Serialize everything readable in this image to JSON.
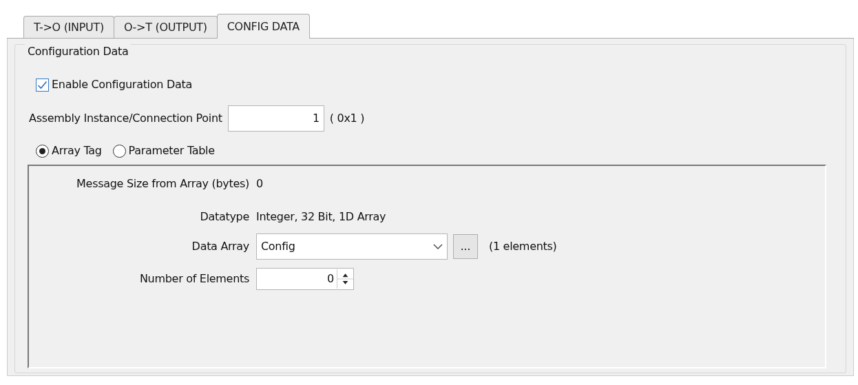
{
  "tabs": [
    {
      "label": "T->O (INPUT)",
      "selected": false
    },
    {
      "label": "O->T (OUTPUT)",
      "selected": false
    },
    {
      "label": "CONFIG DATA",
      "selected": true
    }
  ],
  "group": {
    "title": "Configuration Data",
    "enable": {
      "label": "Enable Configuration Data",
      "checked": true
    },
    "assembly": {
      "label": "Assembly Instance/Connection Point",
      "value": "1",
      "hex": "( 0x1 )"
    },
    "radios": [
      {
        "label": "Array Tag",
        "selected": true
      },
      {
        "label": "Parameter Table",
        "selected": false
      }
    ],
    "details": {
      "message_size": {
        "label": "Message Size from Array (bytes)",
        "value": "0"
      },
      "datatype": {
        "label": "Datatype",
        "value": "Integer, 32 Bit, 1D Array"
      },
      "data_array": {
        "label": "Data Array",
        "value": "Config",
        "browse": "...",
        "count": "(1 elements)"
      },
      "elements": {
        "label": "Number of Elements",
        "value": "0"
      }
    }
  }
}
